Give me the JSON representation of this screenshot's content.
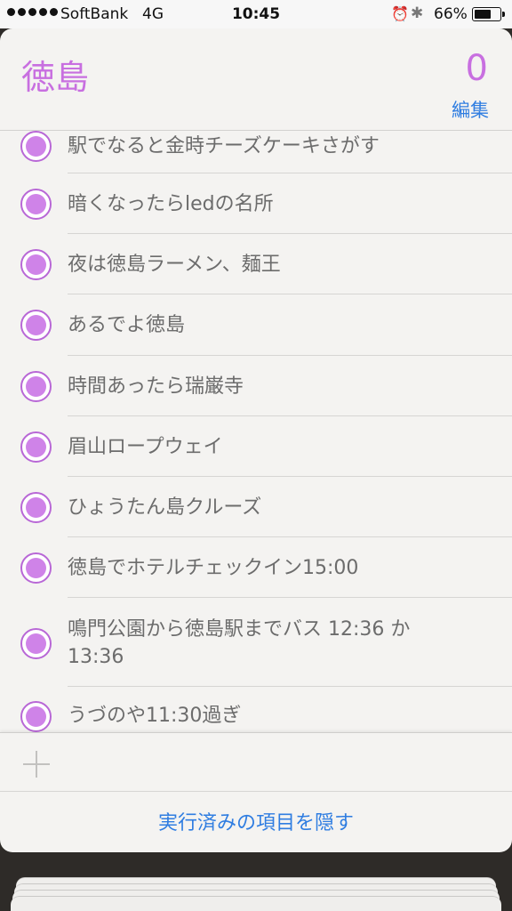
{
  "status_bar": {
    "carrier": "SoftBank",
    "network": "4G",
    "time": "10:45",
    "battery_percent_text": "66%",
    "battery_level": 0.66,
    "alarm_icon": "alarm-clock-icon",
    "bluetooth_icon": "bluetooth-icon"
  },
  "header": {
    "title": "徳島",
    "count": "0",
    "edit_label": "編集"
  },
  "items": [
    {
      "text": "駅でなると金時チーズケーキさがす"
    },
    {
      "text": "暗くなったらledの名所"
    },
    {
      "text": "夜は徳島ラーメン、麺王"
    },
    {
      "text": "あるでよ徳島"
    },
    {
      "text": "時間あったら瑞巌寺"
    },
    {
      "text": "眉山ロープウェイ"
    },
    {
      "text": "ひょうたん島クルーズ"
    },
    {
      "text": "徳島でホテルチェックイン15:00"
    },
    {
      "text": "鳴門公園から徳島駅までバス 12:36 か 13:36"
    },
    {
      "text": "うづのや11:30過ぎ"
    }
  ],
  "footer": {
    "hide_completed_label": "実行済みの項目を隠す"
  },
  "colors": {
    "accent": "#c86fe0",
    "link": "#2f7de1"
  }
}
